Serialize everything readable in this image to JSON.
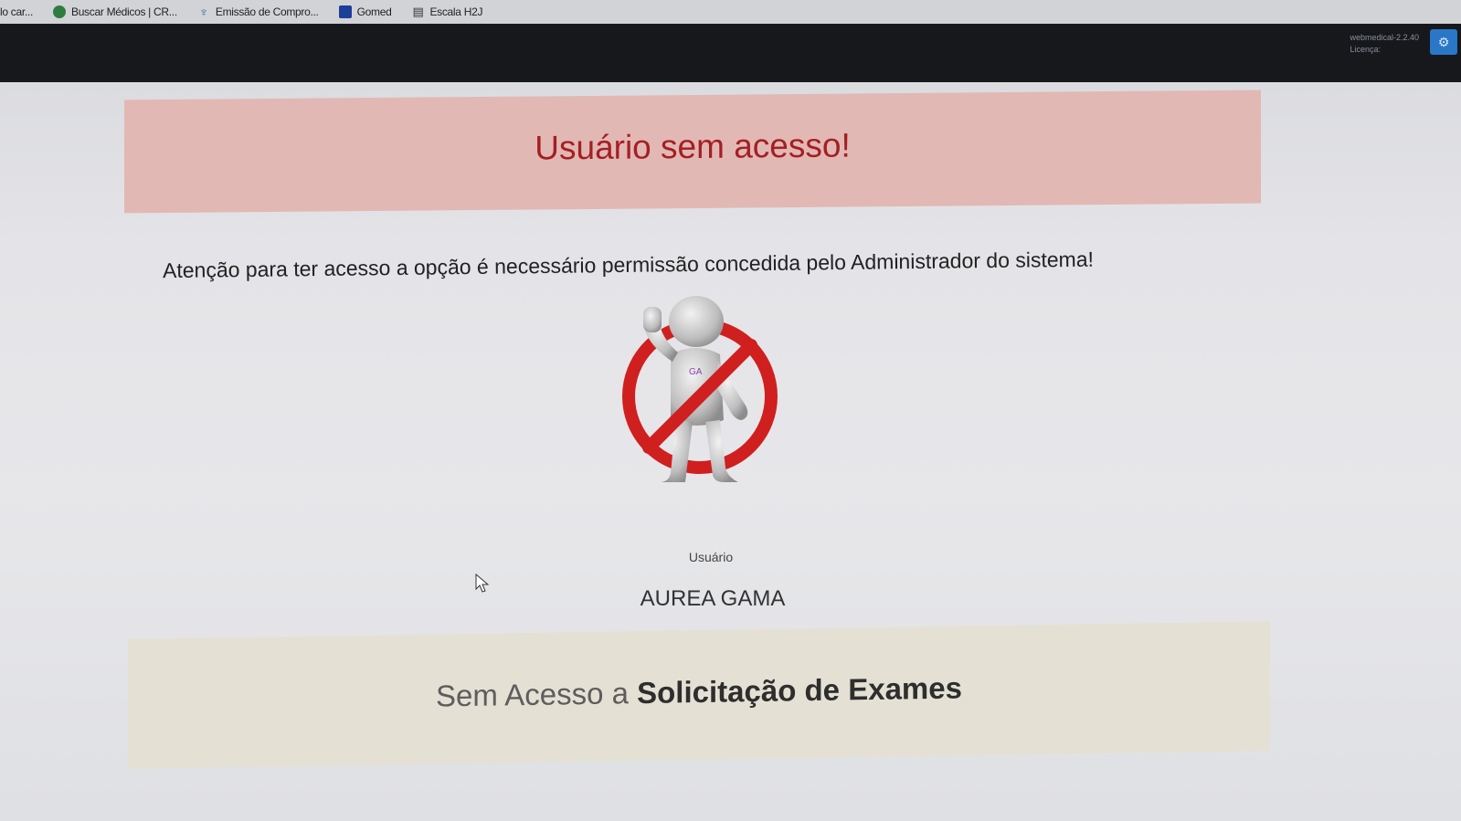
{
  "bookmarks": [
    {
      "label": "lo car...",
      "icon": "none"
    },
    {
      "label": "Buscar Médicos | CR...",
      "icon": "green-circle-icon"
    },
    {
      "label": "Emissão de Compro...",
      "icon": "tree-icon"
    },
    {
      "label": "Gomed",
      "icon": "blue-square-icon"
    },
    {
      "label": "Escala H2J",
      "icon": "document-icon"
    }
  ],
  "header": {
    "version": "webmedical-2.2.40",
    "license_label": "Licença:",
    "settings_icon": "gear-icon"
  },
  "alert": {
    "title": "Usuário sem acesso!"
  },
  "message": "Atenção para ter acesso a opção é necessário permissão concedida pelo Administrador do sistema!",
  "illustration": {
    "icon": "forbidden-person-icon",
    "badge": "GA"
  },
  "user": {
    "label": "Usuário",
    "name": "AUREA GAMA"
  },
  "access_banner": {
    "prefix": "Sem Acesso a ",
    "feature": "Solicitação de Exames"
  },
  "colors": {
    "alert_bg": "#e2b8b4",
    "alert_text": "#a41f24",
    "banner_bg": "#e4e1d4",
    "header_bg": "#16181c"
  }
}
